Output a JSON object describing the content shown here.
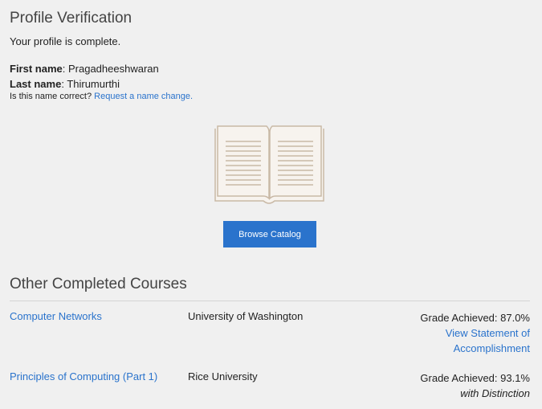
{
  "header": {
    "title": "Profile Verification",
    "status": "Your profile is complete."
  },
  "profile": {
    "first_name_label": "First name",
    "first_name": "Pragadheeshwaran",
    "last_name_label": "Last name",
    "last_name": "Thirumurthi",
    "name_question": "Is this name correct?",
    "name_change_link": "Request a name change."
  },
  "actions": {
    "browse_label": "Browse Catalog"
  },
  "completed": {
    "heading": "Other Completed Courses",
    "courses": [
      {
        "name": "Computer Networks",
        "university": "University of Washington",
        "grade": "Grade Achieved: 87.0%",
        "extra_link": "View Statement of Accomplishment",
        "extra_line1": "View Statement of",
        "extra_line2": "Accomplishment"
      },
      {
        "name": "Principles of Computing (Part 1)",
        "university": "Rice University",
        "grade": "Grade Achieved: 93.1%",
        "extra_note": "with Distinction"
      }
    ]
  },
  "colors": {
    "accent": "#2a73cc",
    "background": "#f0f0f0",
    "book_stroke": "#c9b9a6"
  },
  "icons": [
    "open-book-icon"
  ]
}
